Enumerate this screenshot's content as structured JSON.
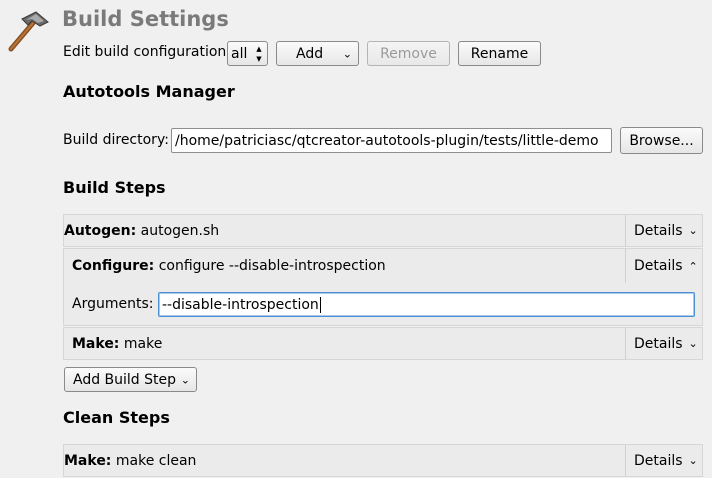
{
  "page": {
    "title": "Build Settings",
    "icon": "hammer-icon"
  },
  "config_bar": {
    "label": "Edit build configuration:",
    "config_value": "all",
    "add_label": "Add",
    "remove_label": "Remove",
    "rename_label": "Rename"
  },
  "autotools": {
    "title": "Autotools Manager",
    "build_dir_label": "Build directory:",
    "build_dir_value": "/home/patriciasc/qtcreator-autotools-plugin/tests/little-demo",
    "browse_label": "Browse..."
  },
  "build_steps": {
    "title": "Build Steps",
    "steps": [
      {
        "name": "Autogen:",
        "command": "autogen.sh",
        "details_label": "Details",
        "expanded": false
      },
      {
        "name": "Configure:",
        "command": "configure --disable-introspection",
        "details_label": "Details",
        "expanded": true,
        "arguments_label": "Arguments:",
        "arguments_value": "--disable-introspection"
      },
      {
        "name": "Make:",
        "command": "make",
        "details_label": "Details",
        "expanded": false
      }
    ],
    "add_step_label": "Add Build Step"
  },
  "clean_steps": {
    "title": "Clean Steps",
    "steps": [
      {
        "name": "Make:",
        "command": "make clean",
        "details_label": "Details",
        "expanded": false
      }
    ]
  },
  "colors": {
    "background": "#f0f0f0",
    "title_gray": "#7a7a7a",
    "focus_blue": "#4c8ed1"
  }
}
